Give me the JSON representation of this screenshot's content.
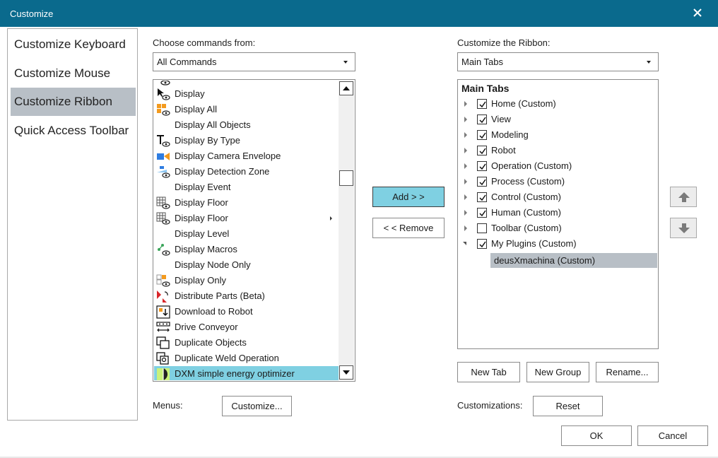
{
  "window": {
    "title": "Customize",
    "close_icon": "close-icon",
    "accent": "#0a6a8d"
  },
  "nav": {
    "items": [
      {
        "label": "Customize Keyboard"
      },
      {
        "label": "Customize Mouse"
      },
      {
        "label": "Customize Ribbon",
        "selected": true
      },
      {
        "label": "Quick Access Toolbar"
      }
    ]
  },
  "commands": {
    "label": "Choose commands from:",
    "source": "All Commands",
    "items": [
      {
        "label": "Display",
        "icon": "display-icon"
      },
      {
        "label": "Display All",
        "icon": "display-all-icon"
      },
      {
        "label": "Display All Objects",
        "icon": ""
      },
      {
        "label": "Display By Type",
        "icon": "display-by-type-icon"
      },
      {
        "label": "Display Camera Envelope",
        "icon": "camera-icon"
      },
      {
        "label": "Display Detection Zone",
        "icon": "detection-zone-icon"
      },
      {
        "label": "Display Event",
        "icon": ""
      },
      {
        "label": "Display Floor",
        "icon": "floor-grid-icon"
      },
      {
        "label": "Display Floor",
        "icon": "floor-grid-icon",
        "has_submenu": true
      },
      {
        "label": "Display Level",
        "icon": ""
      },
      {
        "label": "Display Macros",
        "icon": "macros-icon"
      },
      {
        "label": "Display Node Only",
        "icon": ""
      },
      {
        "label": "Display Only",
        "icon": "display-only-icon"
      },
      {
        "label": "Distribute Parts (Beta)",
        "icon": "distribute-parts-icon"
      },
      {
        "label": "Download to Robot",
        "icon": "download-robot-icon"
      },
      {
        "label": "Drive Conveyor",
        "icon": "conveyor-icon"
      },
      {
        "label": "Duplicate Objects",
        "icon": "duplicate-icon"
      },
      {
        "label": "Duplicate Weld Operation",
        "icon": "weld-icon"
      },
      {
        "label": "DXM simple energy optimizer",
        "icon": "dxm-icon",
        "selected": true
      }
    ]
  },
  "actions": {
    "add": "Add > >",
    "remove": "< < Remove"
  },
  "ribbon": {
    "label": "Customize the Ribbon:",
    "source": "Main Tabs",
    "root": "Main Tabs",
    "items": [
      {
        "label": "Home (Custom)",
        "checked": true
      },
      {
        "label": "View",
        "checked": true
      },
      {
        "label": "Modeling",
        "checked": true
      },
      {
        "label": "Robot",
        "checked": true
      },
      {
        "label": "Operation (Custom)",
        "checked": true
      },
      {
        "label": "Process (Custom)",
        "checked": true
      },
      {
        "label": "Control (Custom)",
        "checked": true
      },
      {
        "label": "Human (Custom)",
        "checked": true
      },
      {
        "label": "Toolbar (Custom)",
        "checked": false
      },
      {
        "label": "My Plugins (Custom)",
        "checked": true,
        "expanded": true
      }
    ],
    "child": "deusXmachina (Custom)",
    "move_up_icon": "arrow-up-icon",
    "move_down_icon": "arrow-down-icon"
  },
  "tree_buttons": {
    "new_tab": "New Tab",
    "new_group": "New Group",
    "rename": "Rename..."
  },
  "menus": {
    "label": "Menus:",
    "button": "Customize..."
  },
  "customizations": {
    "label": "Customizations:",
    "button": "Reset"
  },
  "footer": {
    "ok": "OK",
    "cancel": "Cancel"
  }
}
